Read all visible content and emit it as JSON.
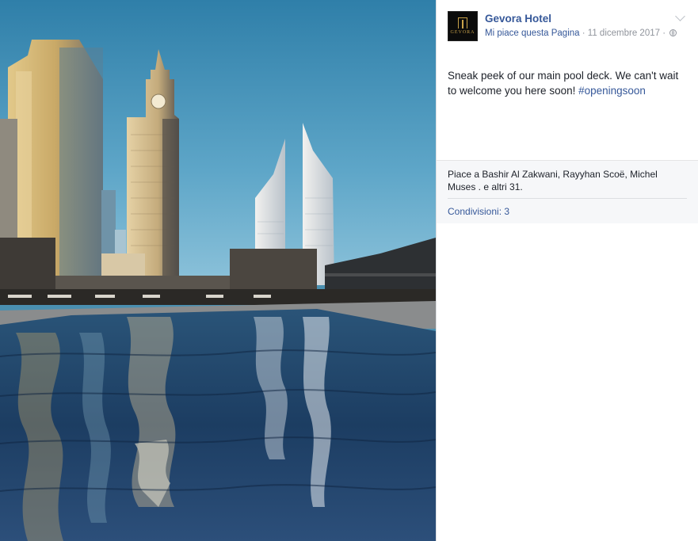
{
  "post": {
    "page_name": "Gevora Hotel",
    "avatar_text": "GEVORA",
    "like_page": "Mi piace questa Pagina",
    "separator": " · ",
    "date": "11 dicembre 2017",
    "separator2": " · ",
    "text": "Sneak peek of our main pool deck. We can't wait to welcome you here soon! ",
    "hashtag": "#openingsoon"
  },
  "feedback": {
    "likes_summary": "Piace a Bashir Al Zakwani, Rayyhan Scoë, Michel Muses . e altri 31.",
    "shares": "Condivisioni: 3"
  },
  "photo": {
    "subject": "Rooftop pool with skyscrapers reflected in the water",
    "sky_color": "#4a8fb4",
    "water_color": "#1a3a5c"
  },
  "icons": {
    "globe": "globe-icon",
    "menu": "chevron-down-icon"
  },
  "colors": {
    "link": "#365899",
    "meta": "#90949c",
    "text": "#1d2129"
  }
}
